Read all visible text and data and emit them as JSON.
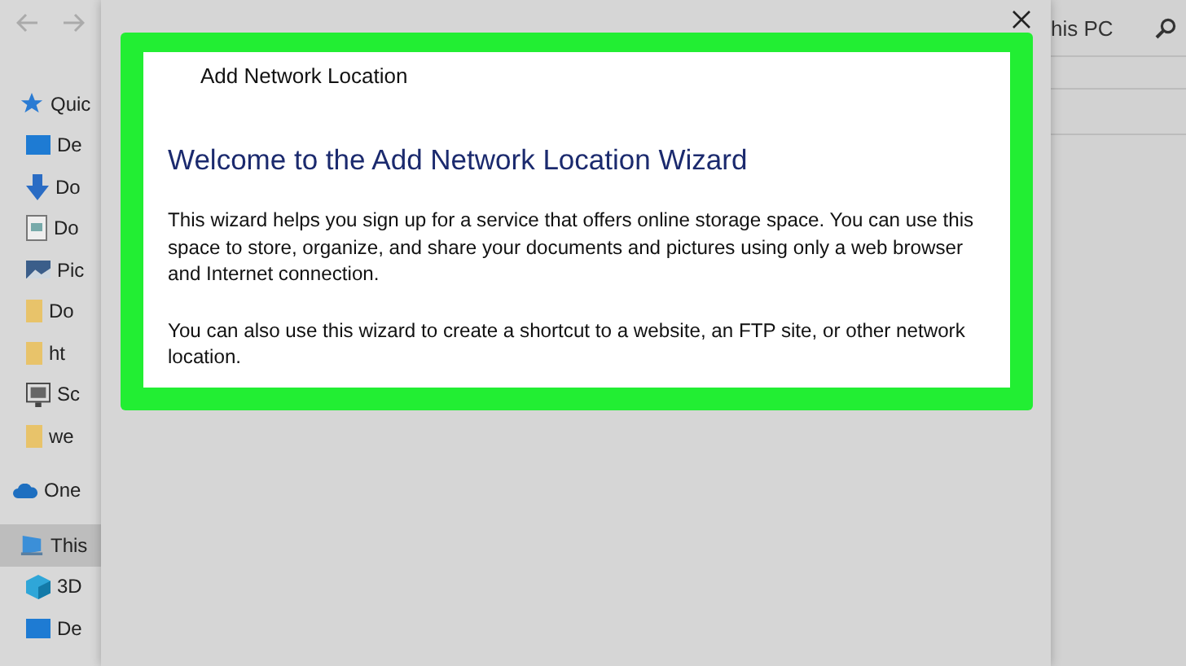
{
  "sidebar": {
    "items": [
      {
        "label": "Quic",
        "selected": false
      },
      {
        "label": "De",
        "selected": false
      },
      {
        "label": "Do",
        "selected": false
      },
      {
        "label": "Do",
        "selected": false
      },
      {
        "label": "Pic",
        "selected": false
      },
      {
        "label": "Do",
        "selected": false
      },
      {
        "label": "ht",
        "selected": false
      },
      {
        "label": "Sc",
        "selected": false
      },
      {
        "label": "we",
        "selected": false
      },
      {
        "label": "One",
        "selected": false
      },
      {
        "label": "This",
        "selected": true
      },
      {
        "label": "3D",
        "selected": false
      },
      {
        "label": "De",
        "selected": false
      }
    ]
  },
  "dialog": {
    "title": "Add Network Location",
    "heading": "Welcome to the Add Network Location Wizard",
    "paragraphs": [
      "This wizard helps you sign up for a service that offers online storage space.  You can use this space to store, organize, and share your documents and pictures using only a web browser and Internet connection.",
      "You can also use this wizard to create a shortcut to a website, an FTP site, or other network location."
    ]
  },
  "address_bar": {
    "text": "his PC"
  }
}
